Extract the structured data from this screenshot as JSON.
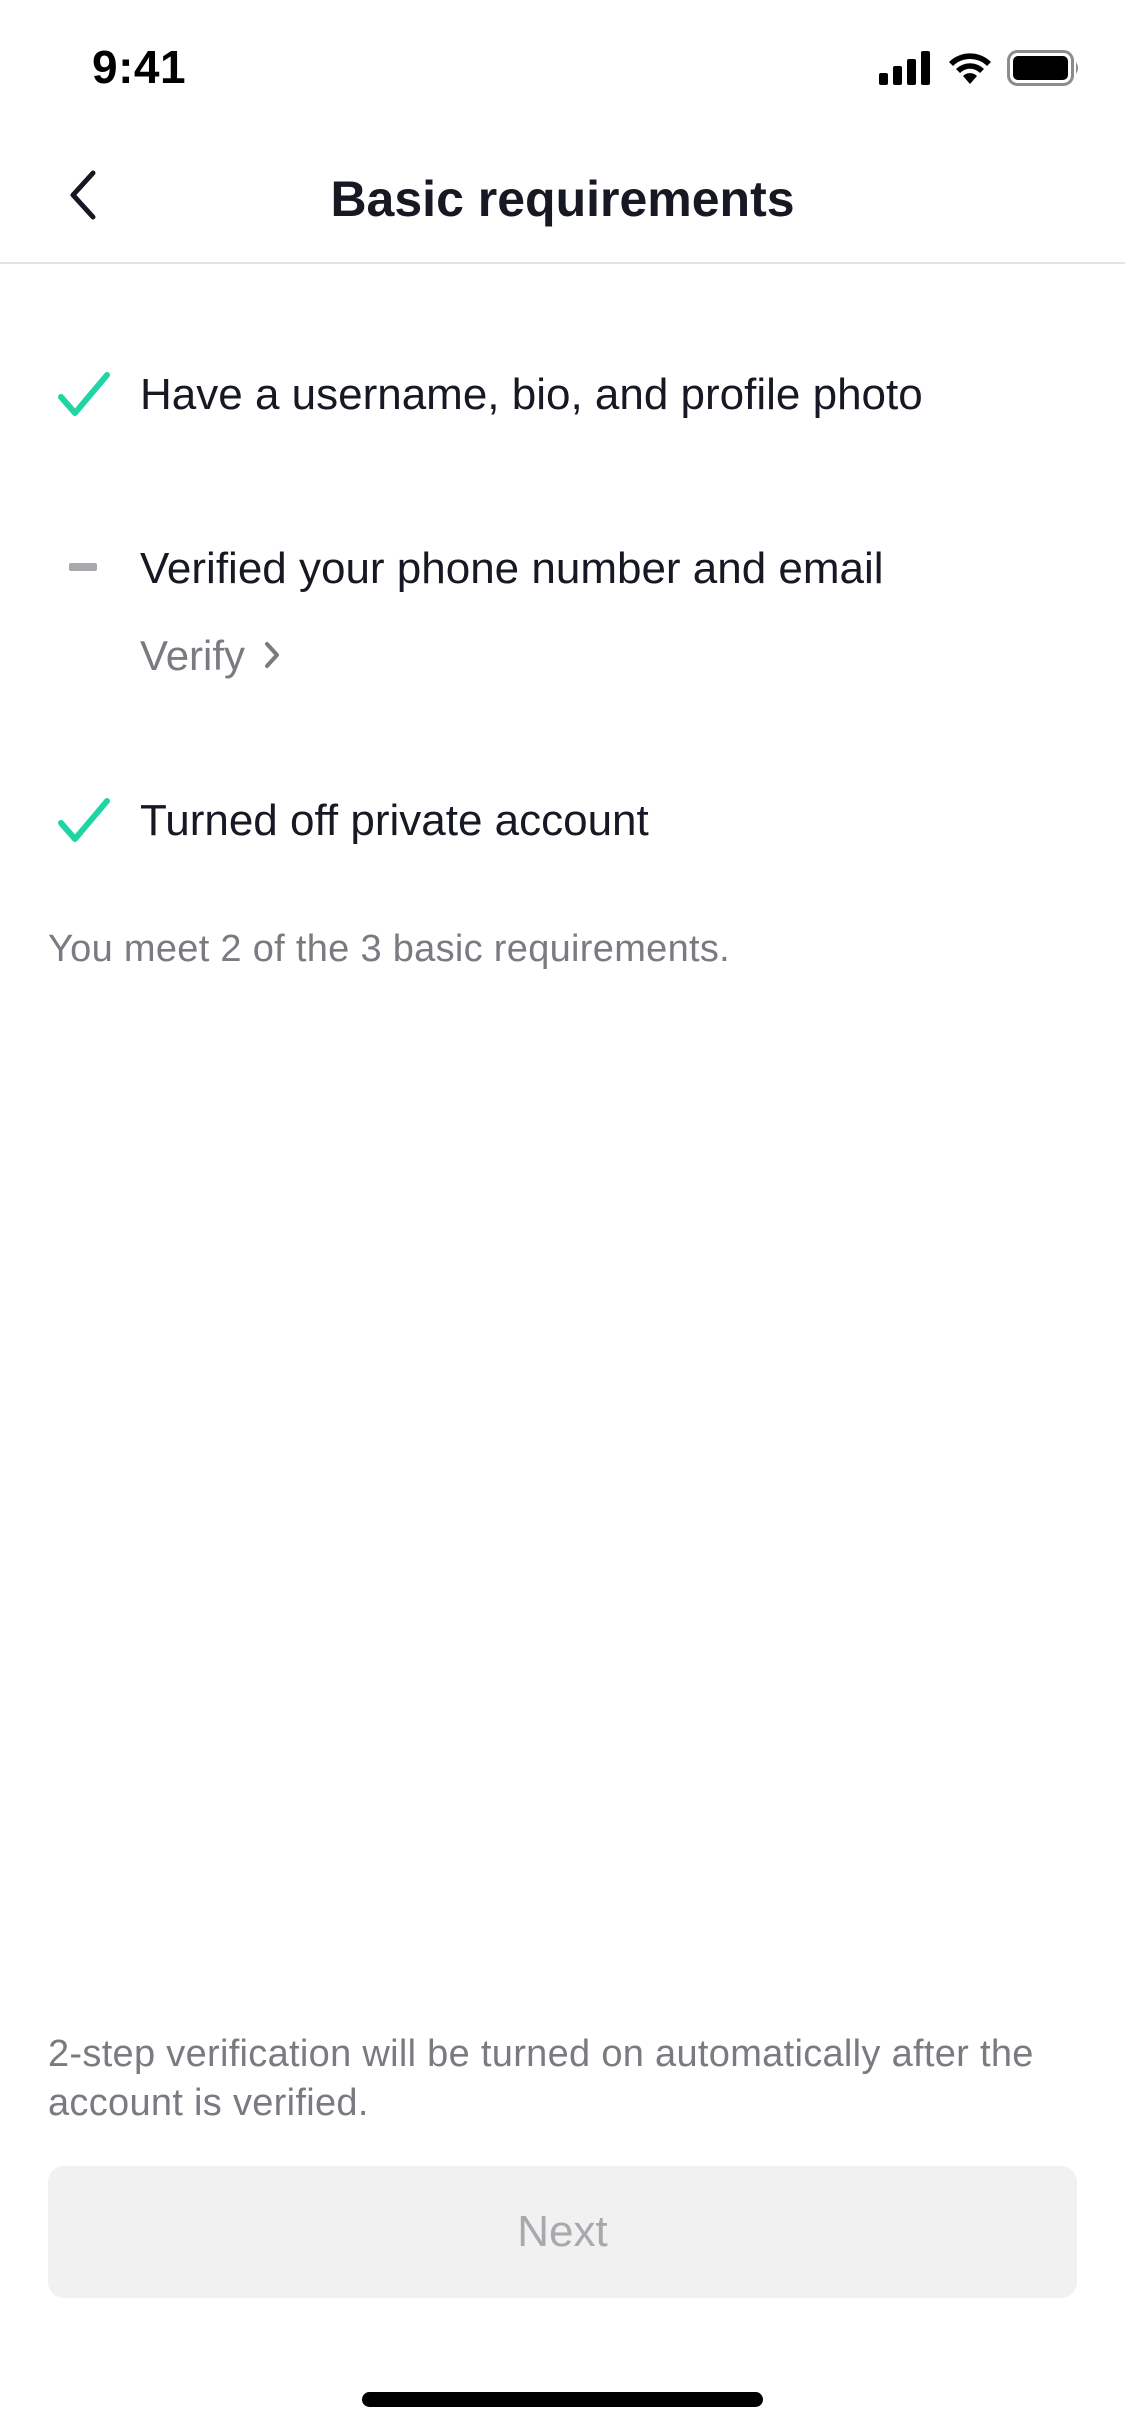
{
  "status_bar": {
    "time": "9:41"
  },
  "nav": {
    "title": "Basic requirements"
  },
  "requirements": [
    {
      "label": "Have a username, bio, and profile photo",
      "status": "met"
    },
    {
      "label": "Verified your phone number and email",
      "status": "unmet",
      "action_label": "Verify"
    },
    {
      "label": "Turned off private account",
      "status": "met"
    }
  ],
  "summary": "You meet 2 of the 3 basic requirements.",
  "footer": {
    "note": "2-step verification will be turned on automatically after the account is verified.",
    "next_label": "Next"
  },
  "colors": {
    "check": "#20d5a4",
    "dash": "#a8a9ad",
    "muted_text": "#7a7b80",
    "button_bg": "#f1f1f2",
    "button_text": "#a8a9ad"
  }
}
